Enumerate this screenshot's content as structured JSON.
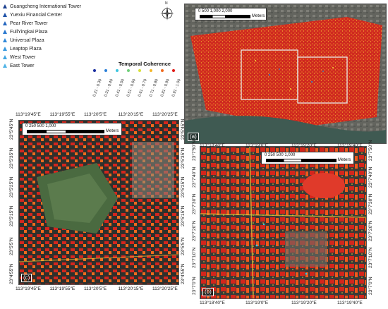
{
  "legend": {
    "towers": [
      "Guangcheng International Tower",
      "Yuexiu Financial Center",
      "Pear River Tower",
      "FullYingkai Plaza",
      "Universal Plaza",
      "Leaptop Plaza",
      "West Tower",
      "East Tower"
    ],
    "tower_colors": [
      "#1b3f8f",
      "#1f52a8",
      "#2466bf",
      "#2a78cf",
      "#3088d8",
      "#3898de",
      "#42a6e2",
      "#4fb3e6"
    ],
    "compass_label": "N",
    "coherence_title": "Temporal Coherence",
    "coherence_classes": [
      {
        "label": "0.21 - 0.30",
        "color": "#1a2ea0"
      },
      {
        "label": "0.31 - 0.40",
        "color": "#2a7fd8"
      },
      {
        "label": "0.41 - 0.50",
        "color": "#3cc6e0"
      },
      {
        "label": "0.51 - 0.60",
        "color": "#6fd07a"
      },
      {
        "label": "0.61 - 0.70",
        "color": "#d8e03a"
      },
      {
        "label": "0.71 - 0.80",
        "color": "#f4b72a"
      },
      {
        "label": "0.81 - 0.90",
        "color": "#f06a1e"
      },
      {
        "label": "0.91 - 1.00",
        "color": "#e01a16"
      }
    ]
  },
  "panel_a": {
    "tag": "(a)",
    "scale_ticks": "0    500  1,000         2,000",
    "scale_unit": "Meters"
  },
  "panel_b": {
    "tag": "(b)",
    "scale_ticks": "0    250   500          1,000",
    "scale_unit": "Meters",
    "top_coords": [
      "113°18'40\"E",
      "113°19'0\"E",
      "113°19'20\"E",
      "113°19'40\"E"
    ],
    "bottom_coords": [
      "113°18'40\"E",
      "113°19'0\"E",
      "113°19'20\"E",
      "113°19'40\"E"
    ],
    "left_coords": [
      "23°7'50\"N",
      "23°7'40\"N",
      "23°7'30\"N",
      "23°7'20\"N",
      "23°7'10\"N",
      "23°7'0\"N"
    ],
    "right_coords": [
      "23°7'50\"N",
      "23°7'40\"N",
      "23°7'30\"N",
      "23°7'20\"N",
      "23°7'10\"N",
      "23°7'0\"N"
    ]
  },
  "panel_c": {
    "tag": "(c)",
    "scale_ticks": "0    250    500         1,000",
    "scale_unit": "Meters",
    "top_coords": [
      "113°19'45\"E",
      "113°19'55\"E",
      "113°20'5\"E",
      "113°20'15\"E",
      "113°20'25\"E"
    ],
    "bottom_coords": [
      "113°19'45\"E",
      "113°19'55\"E",
      "113°20'5\"E",
      "113°20'15\"E",
      "113°20'25\"E"
    ],
    "left_coords": [
      "23°5'45\"N",
      "23°5'35\"N",
      "23°5'25\"N",
      "23°5'15\"N",
      "23°5'5\"N",
      "23°4'55\"N"
    ],
    "right_coords": [
      "23°5'45\"N",
      "23°5'35\"N",
      "23°5'25\"N",
      "23°5'15\"N",
      "23°5'5\"N",
      "23°4'55\"N"
    ]
  }
}
